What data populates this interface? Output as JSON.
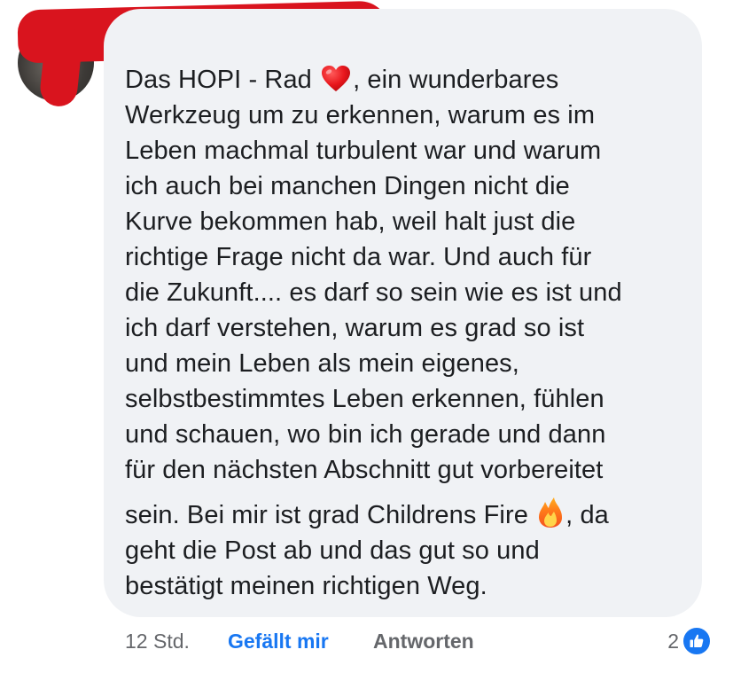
{
  "comment": {
    "lines": [
      [
        "Das HOPI - Rad ",
        ", ein wunderbares"
      ],
      "Werkzeug um zu erkennen, warum es im",
      "Leben machmal turbulent war und warum",
      "ich auch bei manchen Dingen nicht die",
      "Kurve bekommen hab, weil halt just die",
      "richtige Frage nicht da war. Und auch für",
      "die Zukunft.... es darf so sein wie es ist und",
      "ich darf verstehen, warum es grad so ist",
      "und mein Leben als mein eigenes,",
      "selbstbestimmtes Leben erkennen, fühlen",
      "und schauen, wo bin ich gerade und dann",
      "für den nächsten Abschnitt gut vorbereitet",
      [
        "sein. Bei mir ist grad Childrens Fire ",
        ", da"
      ],
      "geht die Post ab und das gut so und",
      "bestätigt meinen richtigen Weg."
    ],
    "emojis": {
      "heart": "red-heart-emoji",
      "fire": "fire-emoji"
    }
  },
  "footer": {
    "timestamp": "12 Std.",
    "like_label": "Gefällt mir",
    "reply_label": "Antworten",
    "reaction_count": "2"
  },
  "colors": {
    "bubble": "#f0f2f5",
    "text": "#1c1e21",
    "meta": "#65676b",
    "accent": "#1877f2",
    "redaction": "#d9141e"
  }
}
